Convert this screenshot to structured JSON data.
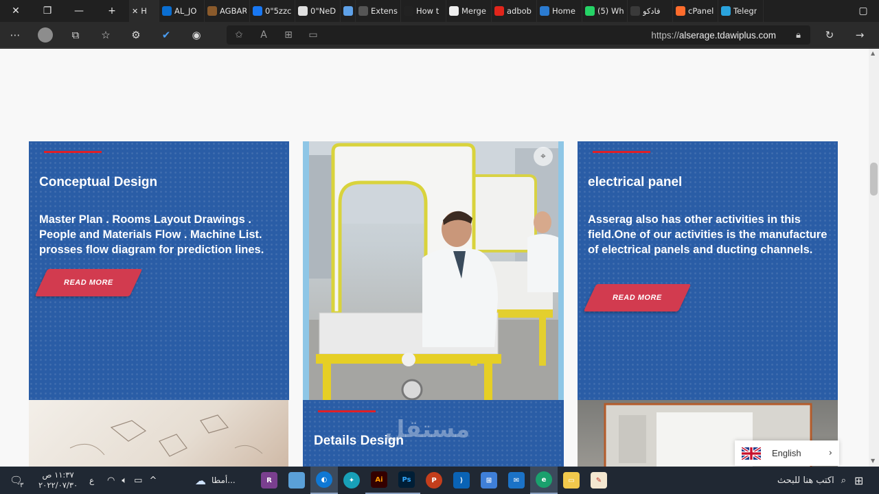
{
  "tabs": [
    {
      "label": "H",
      "fav": "#3b6ea5",
      "active": true
    },
    {
      "label": "AL_JO",
      "fav": "#0a6ed1"
    },
    {
      "label": "AGBAR",
      "fav": "#8a5a2b"
    },
    {
      "label": "0\"5zzc",
      "fav": "#1877f2"
    },
    {
      "label": "0\"NeD",
      "fav": "#e0e0e0"
    },
    {
      "label": "",
      "fav": "#5ea1e8"
    },
    {
      "label": "Extens",
      "fav": "#555555"
    },
    {
      "label": "How t",
      "fav": "#222222"
    },
    {
      "label": "Merge",
      "fav": "#eeeeee"
    },
    {
      "label": "adbob",
      "fav": "#e1251b"
    },
    {
      "label": "Home",
      "fav": "#2b7bd1"
    },
    {
      "label": "(5) Wh",
      "fav": "#25d366"
    },
    {
      "label": "فادكو",
      "fav": "#3a3a3a"
    },
    {
      "label": "cPanel",
      "fav": "#ff6c2c"
    },
    {
      "label": "Telegr",
      "fav": "#2aa3dd"
    }
  ],
  "window": {
    "close": "✕",
    "restore": "❐",
    "minimize": "—",
    "new_tab": "+"
  },
  "address": {
    "scheme": "https://",
    "host": "alserage.tdawiplus.com"
  },
  "cards": {
    "conceptual": {
      "title": "Conceptual Design",
      "body": "Master Plan . Rooms Layout Drawings . People and Materials Flow . Machine List. prosses flow diagram for prediction lines.",
      "button": "READ MORE"
    },
    "electrical": {
      "title": "electrical panel",
      "body": "Asserag also has other activities in this field.One of our activities is the manufacture of electrical panels and ducting channels.",
      "button": "READ MORE"
    },
    "details": {
      "title": "Details Design"
    }
  },
  "language": {
    "label": "English"
  },
  "watermark": "مستقل",
  "taskbar": {
    "search_placeholder": "اكتب هنا للبحث",
    "weather": "أمطا...",
    "time": "١١:٣٧ ص",
    "date": "٢٠٢٢/٠٧/٣٠",
    "lang": "ع",
    "notifications": "٣"
  }
}
